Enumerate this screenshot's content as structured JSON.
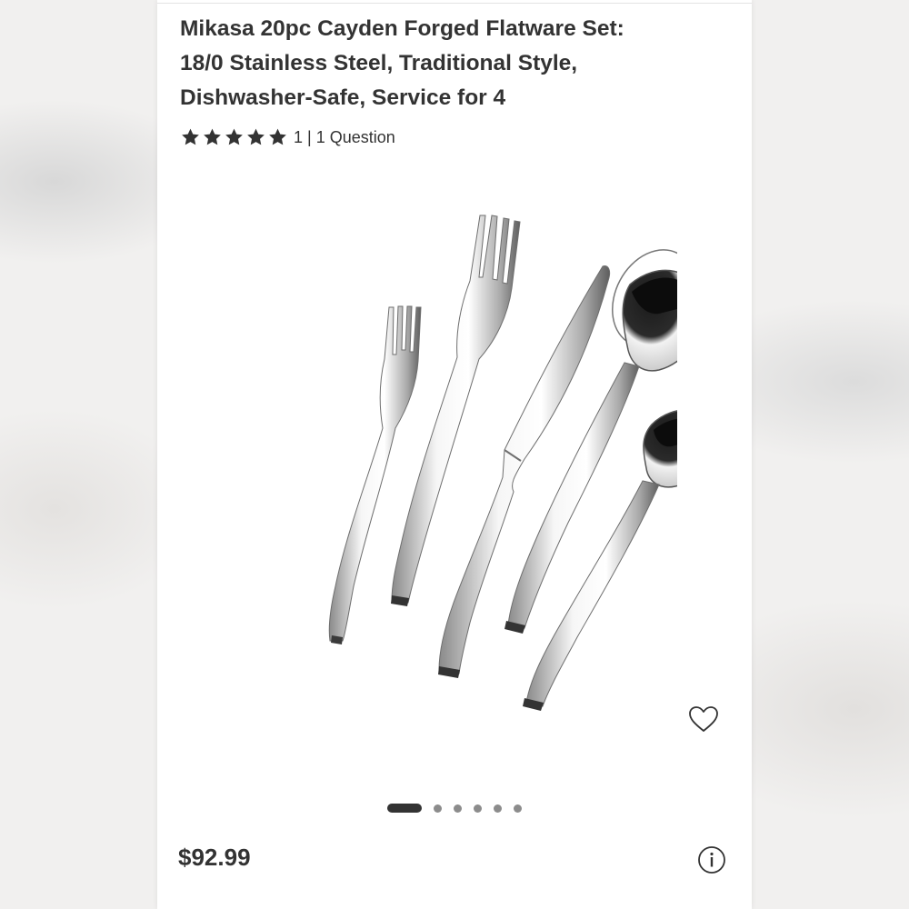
{
  "product": {
    "title_line1": "Mikasa 20pc Cayden Forged Flatware Set:",
    "title_line2": "18/0 Stainless Steel, Traditional Style,",
    "title_line3": "Dishwasher-Safe, Service for 4",
    "rating": {
      "stars": 5,
      "text": "1 | 1 Question"
    },
    "price": "$92.99"
  },
  "gallery": {
    "image_count": 6,
    "active_index": 0
  },
  "icons": {
    "star": "star-icon",
    "wishlist": "heart-outline-icon",
    "info": "info-circle-icon"
  },
  "colors": {
    "text": "#333333",
    "dot_inactive": "#8c8c8c",
    "dot_active": "#333333"
  }
}
